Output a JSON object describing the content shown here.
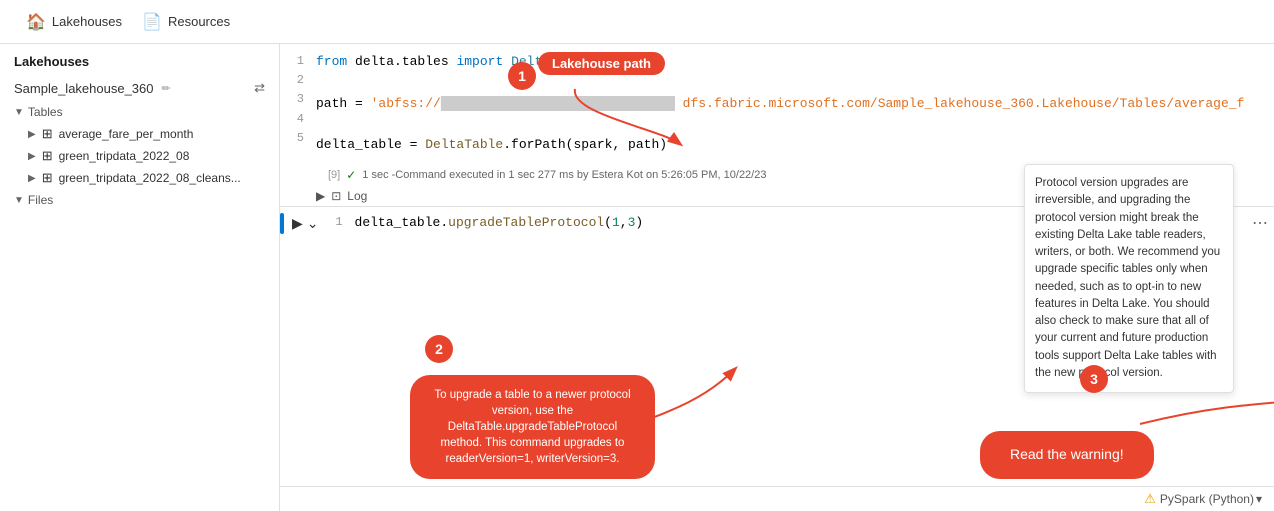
{
  "nav": {
    "lakehouses_label": "Lakehouses",
    "resources_label": "Resources"
  },
  "sidebar": {
    "title": "Lakehouses",
    "workspace_name": "Sample_lakehouse_360",
    "sections": [
      {
        "label": "Tables"
      },
      {
        "label": "Files"
      }
    ],
    "tables": [
      {
        "name": "average_fare_per_month"
      },
      {
        "name": "green_tripdata_2022_08"
      },
      {
        "name": "green_tripdata_2022_08_cleans..."
      }
    ]
  },
  "code_cell_1": {
    "lines": [
      {
        "num": "1",
        "content": "from delta.tables import DeltaTable"
      },
      {
        "num": "2",
        "content": ""
      },
      {
        "num": "3",
        "content": "path = 'abfss://██████████████ dfs.fabric.microsoft.com/Sample_lakehouse_360.Lakehouse/Tables/average_f"
      },
      {
        "num": "4",
        "content": ""
      },
      {
        "num": "5",
        "content": "delta_table = DeltaTable.forPath(spark, path)"
      }
    ],
    "exec_cell_num": "[9]",
    "exec_status": "1 sec -Command executed in 1 sec 277 ms by Estera Kot on 5:26:05 PM, 10/22/23",
    "log_label": "Log"
  },
  "code_cell_2": {
    "lines": [
      {
        "num": "1",
        "content": "delta_table.upgradeTableProtocol(1,3)"
      }
    ]
  },
  "warning_tooltip": {
    "text": "Protocol version upgrades are irreversible, and upgrading the protocol version might break the existing Delta Lake table readers, writers, or both. We recommend you upgrade specific tables only when needed, such as to opt-in to new features in Delta Lake. You should also check to make sure that all of your current and future production tools support Delta Lake tables with the new protocol version."
  },
  "bottom_bar": {
    "label": "PySpark (Python)",
    "chevron": "▾"
  },
  "annotations": {
    "num1": "1",
    "label1": "Lakehouse path",
    "num2": "2",
    "label2": "To upgrade a table to a newer protocol version, use the DeltaTable.upgradeTableProtocol method. This command upgrades to readerVersion=1, writerVersion=3.",
    "num3": "3",
    "label3": "Read the warning!"
  }
}
